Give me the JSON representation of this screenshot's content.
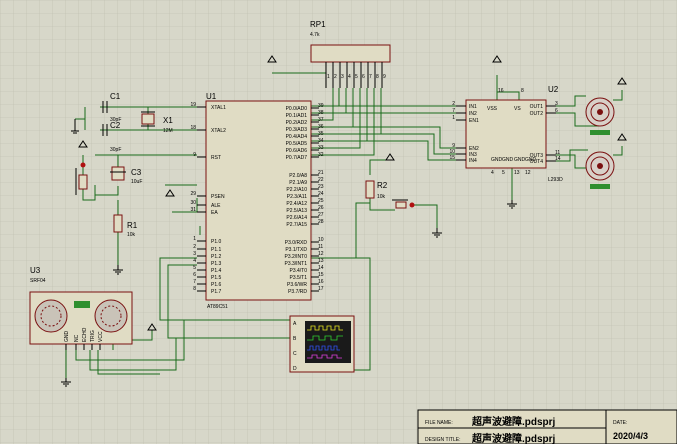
{
  "u1": {
    "ref": "U1",
    "part": "AT89C51",
    "left_pins": [
      {
        "num": "19",
        "name": "XTAL1"
      },
      {
        "num": "18",
        "name": "XTAL2"
      },
      {
        "num": "9",
        "name": "RST"
      },
      {
        "num": "29",
        "name": "PSEN"
      },
      {
        "num": "30",
        "name": "ALE"
      },
      {
        "num": "31",
        "name": "EA"
      },
      {
        "num": "1",
        "name": "P1.0"
      },
      {
        "num": "2",
        "name": "P1.1"
      },
      {
        "num": "3",
        "name": "P1.2"
      },
      {
        "num": "4",
        "name": "P1.3"
      },
      {
        "num": "5",
        "name": "P1.4"
      },
      {
        "num": "6",
        "name": "P1.5"
      },
      {
        "num": "7",
        "name": "P1.6"
      },
      {
        "num": "8",
        "name": "P1.7"
      }
    ],
    "right_pins": [
      {
        "num": "39",
        "name": "P0.0/AD0"
      },
      {
        "num": "38",
        "name": "P0.1/AD1"
      },
      {
        "num": "37",
        "name": "P0.2/AD2"
      },
      {
        "num": "36",
        "name": "P0.3/AD3"
      },
      {
        "num": "35",
        "name": "P0.4/AD4"
      },
      {
        "num": "34",
        "name": "P0.5/AD5"
      },
      {
        "num": "33",
        "name": "P0.6/AD6"
      },
      {
        "num": "32",
        "name": "P0.7/AD7"
      },
      {
        "num": "21",
        "name": "P2.0/A8"
      },
      {
        "num": "22",
        "name": "P2.1/A9"
      },
      {
        "num": "23",
        "name": "P2.2/A10"
      },
      {
        "num": "24",
        "name": "P2.3/A11"
      },
      {
        "num": "25",
        "name": "P2.4/A12"
      },
      {
        "num": "26",
        "name": "P2.5/A13"
      },
      {
        "num": "27",
        "name": "P2.6/A14"
      },
      {
        "num": "28",
        "name": "P2.7/A15"
      },
      {
        "num": "10",
        "name": "P3.0/RXD"
      },
      {
        "num": "11",
        "name": "P3.1/TXD"
      },
      {
        "num": "12",
        "name": "P3.2/INT0"
      },
      {
        "num": "13",
        "name": "P3.3/INT1"
      },
      {
        "num": "14",
        "name": "P3.4/T0"
      },
      {
        "num": "15",
        "name": "P3.5/T1"
      },
      {
        "num": "16",
        "name": "P3.6/WR"
      },
      {
        "num": "17",
        "name": "P3.7/RD"
      }
    ]
  },
  "rp1": {
    "ref": "RP1",
    "value": "4.7k",
    "pins": [
      "1",
      "2",
      "3",
      "4",
      "5",
      "6",
      "7",
      "8",
      "9"
    ]
  },
  "u2": {
    "ref": "U2",
    "part": "L293D",
    "top_pins": {
      "vss": "16",
      "vs": "8"
    },
    "bottom_pins": [
      "4",
      "5",
      "13",
      "12"
    ],
    "left_pins": [
      {
        "num": "2",
        "name": "IN1"
      },
      {
        "num": "7",
        "name": "IN2"
      },
      {
        "num": "1",
        "name": "EN1"
      },
      {
        "num": "9",
        "name": "EN2"
      },
      {
        "num": "10",
        "name": "IN3"
      },
      {
        "num": "15",
        "name": "IN4"
      }
    ],
    "right_pins": [
      {
        "num": "3",
        "name": "OUT1"
      },
      {
        "num": "6",
        "name": "OUT2"
      },
      {
        "num": "11",
        "name": "OUT3"
      },
      {
        "num": "14",
        "name": "OUT4"
      }
    ],
    "vss_label": "VSS",
    "vs_label": "VS",
    "gnd_labels": [
      "GND",
      "GND",
      "GND",
      "GND"
    ]
  },
  "c1": {
    "ref": "C1",
    "value": "30pF"
  },
  "c2": {
    "ref": "C2",
    "value": "30pF"
  },
  "x1": {
    "ref": "X1",
    "value": "12M"
  },
  "c3": {
    "ref": "C3",
    "value": "10uF"
  },
  "r1": {
    "ref": "R1",
    "value": "10k"
  },
  "r2": {
    "ref": "R2",
    "value": "10k"
  },
  "u3": {
    "ref": "U3",
    "part": "SRF04",
    "pins": [
      "GND",
      "NC",
      "ECHO",
      "TRIG",
      "VCC"
    ]
  },
  "scope": {
    "channels": [
      "A",
      "B",
      "C",
      "D"
    ]
  },
  "title_block": {
    "file_name_label": "FILE NAME:",
    "file_name": "超声波避障.pdsprj",
    "design_title_label": "DESIGN TITLE:",
    "design_title": "超声波避障.pdsprj",
    "date_label": "DATE:",
    "date": "2020/4/3"
  },
  "colors": {
    "background": "#d7d7c9",
    "wire": "#1a6b1a",
    "part_fill": "#e0dcc4",
    "part_outline": "#7a1010"
  }
}
